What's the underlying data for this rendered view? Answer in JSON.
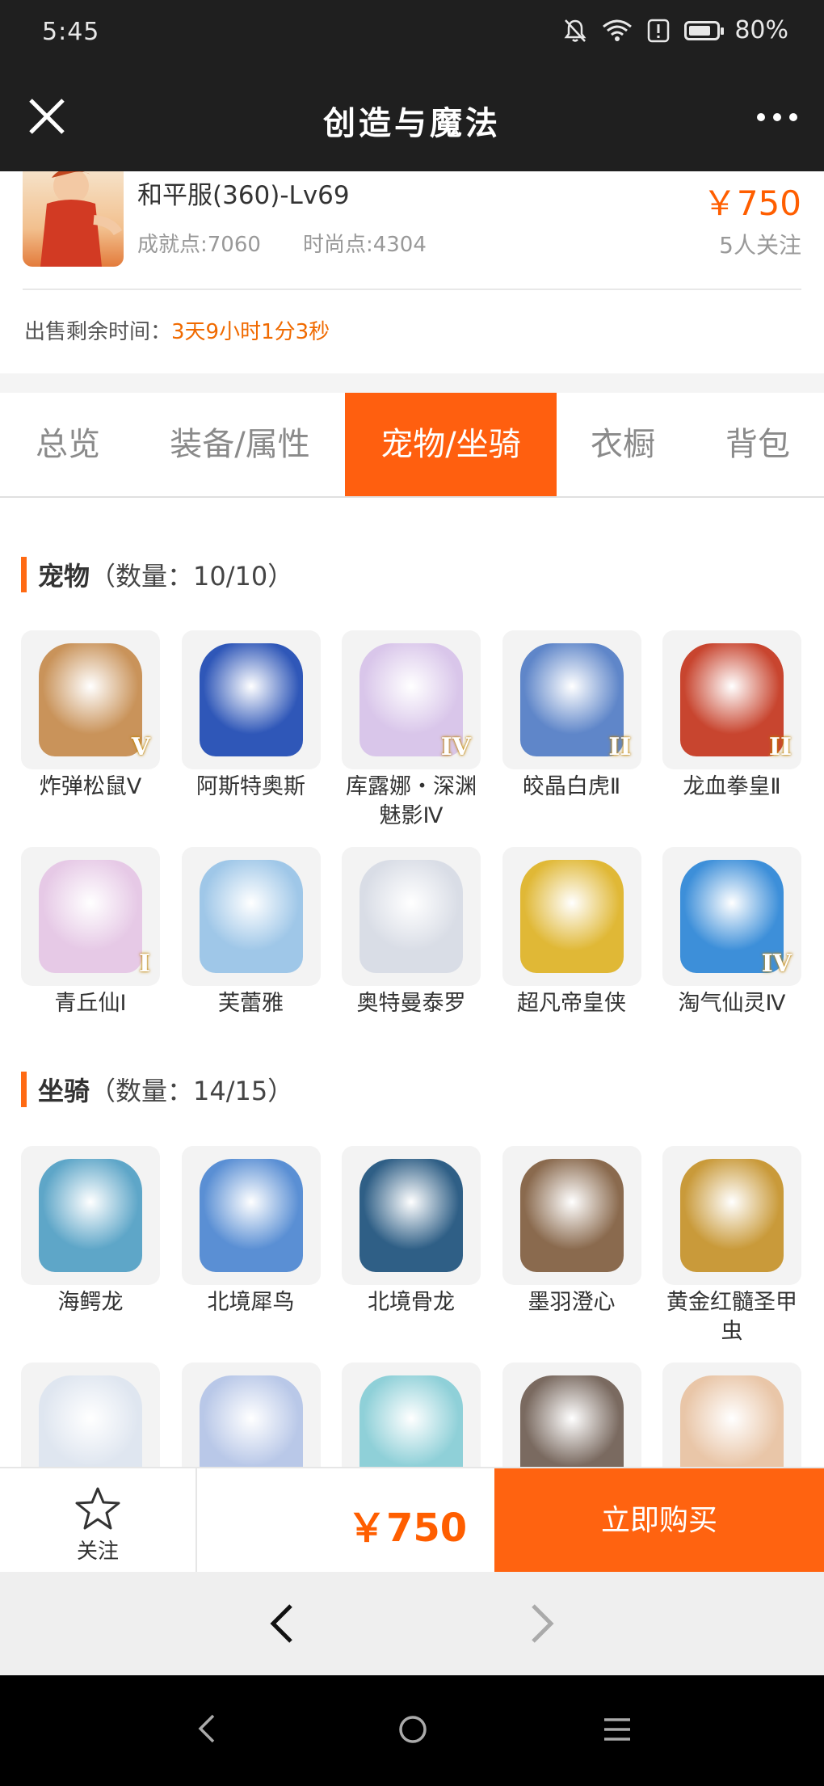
{
  "status_bar": {
    "time": "5:45",
    "battery": "80%",
    "battery_level": 0.8
  },
  "header": {
    "title": "创造与魔法"
  },
  "listing": {
    "server": "和平服(360)-Lv69",
    "price": "￥750",
    "achievement": "成就点:7060",
    "fashion": "时尚点:4304",
    "followers": "5人关注",
    "remaining_label": "出售剩余时间：",
    "remaining_value": "3天9小时1分3秒"
  },
  "tabs": [
    {
      "label": "总览"
    },
    {
      "label": "装备/属性"
    },
    {
      "label": "宠物/坐骑",
      "active": true
    },
    {
      "label": "衣橱"
    },
    {
      "label": "背包"
    }
  ],
  "pets": {
    "title": "宠物",
    "count": "（数量：10/10）",
    "items": [
      {
        "name": "炸弹松鼠Ⅴ",
        "badge": "V",
        "color": "#c9935a"
      },
      {
        "name": "阿斯特奥斯",
        "badge": "",
        "color": "#2f57b8"
      },
      {
        "name": "库露娜・深渊魅影Ⅳ",
        "badge": "IV",
        "color": "#d9c6ea"
      },
      {
        "name": "皎晶白虎Ⅱ",
        "badge": "II",
        "color": "#5f86c9"
      },
      {
        "name": "龙血拳皇Ⅱ",
        "badge": "II",
        "color": "#c8452f"
      },
      {
        "name": "青丘仙I",
        "badge": "I",
        "color": "#e6c9e6"
      },
      {
        "name": "芙蕾雅",
        "badge": "",
        "color": "#9fc7e8"
      },
      {
        "name": "奥特曼泰罗",
        "badge": "",
        "color": "#d9dde6"
      },
      {
        "name": "超凡帝皇侠",
        "badge": "",
        "color": "#e0b836"
      },
      {
        "name": "淘气仙灵Ⅳ",
        "badge": "IV",
        "color": "#3d8fd9"
      }
    ]
  },
  "mounts": {
    "title": "坐骑",
    "count": "（数量：14/15）",
    "items": [
      {
        "name": "海鳄龙",
        "color": "#5ea6c8"
      },
      {
        "name": "北境犀鸟",
        "color": "#5a8fd4"
      },
      {
        "name": "北境骨龙",
        "color": "#2f5f86"
      },
      {
        "name": "墨羽澄心",
        "color": "#8a6a4e"
      },
      {
        "name": "黄金红髓圣甲虫",
        "color": "#c99a3a"
      },
      {
        "name": "",
        "color": "#dfe6f0"
      },
      {
        "name": "",
        "color": "#b9c8e8"
      },
      {
        "name": "",
        "color": "#8fd0d8"
      },
      {
        "name": "",
        "color": "#7a6a60"
      },
      {
        "name": "",
        "color": "#e9c6a8"
      }
    ]
  },
  "bottom_bar": {
    "follow_label": "关注",
    "price": "￥750",
    "buy_label": "立即购买"
  }
}
